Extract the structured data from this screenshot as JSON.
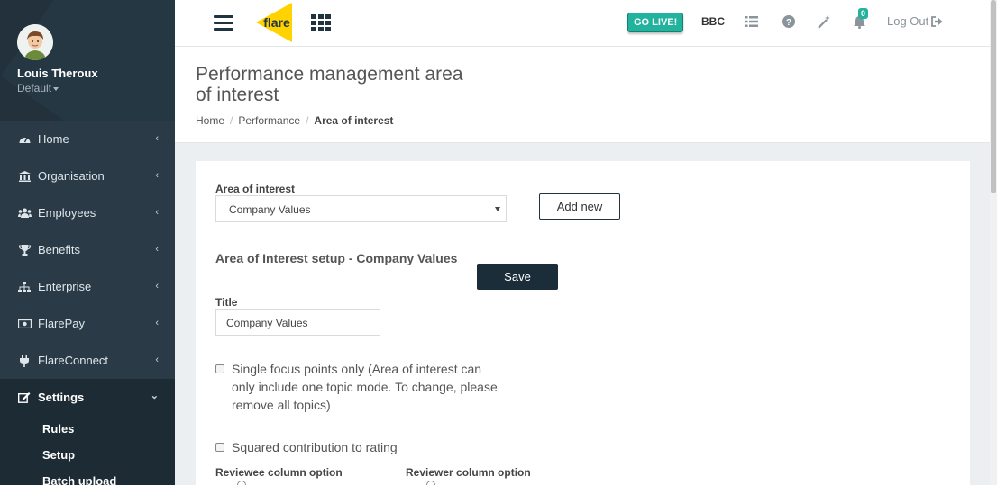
{
  "user": {
    "name": "Louis Theroux",
    "role": "Default"
  },
  "sidebar": {
    "items": [
      {
        "label": "Home",
        "icon": "dashboard-icon"
      },
      {
        "label": "Organisation",
        "icon": "bank-icon"
      },
      {
        "label": "Employees",
        "icon": "users-icon"
      },
      {
        "label": "Benefits",
        "icon": "trophy-icon"
      },
      {
        "label": "Enterprise",
        "icon": "sitemap-icon"
      },
      {
        "label": "FlarePay",
        "icon": "money-icon"
      },
      {
        "label": "FlareConnect",
        "icon": "plug-icon"
      },
      {
        "label": "Settings",
        "icon": "edit-icon"
      }
    ],
    "settings_sub": [
      "Rules",
      "Setup",
      "Batch upload"
    ]
  },
  "topbar": {
    "logo_text": "flare",
    "go_live": "GO LIVE!",
    "company": "BBC",
    "notifications": "0",
    "logout": "Log Out"
  },
  "page": {
    "title": "Performance management area of interest",
    "breadcrumb": [
      "Home",
      "Performance",
      "Area of interest"
    ]
  },
  "form": {
    "area_label": "Area of interest",
    "area_value": "Company Values",
    "add_new": "Add new",
    "setup_title": "Area of Interest setup - Company Values",
    "save": "Save",
    "title_label": "Title",
    "title_value": "Company Values",
    "single_focus": "Single focus points only (Area of interest can only include one topic mode. To change, please remove all topics)",
    "squared": "Squared contribution to rating",
    "reviewee_label": "Reviewee column option",
    "reviewer_label": "Reviewer column option"
  },
  "colors": {
    "sidebar": "#2a3b47",
    "accent": "#21b39d",
    "primary_dark": "#1a2d38",
    "logo": "#ffd200"
  }
}
